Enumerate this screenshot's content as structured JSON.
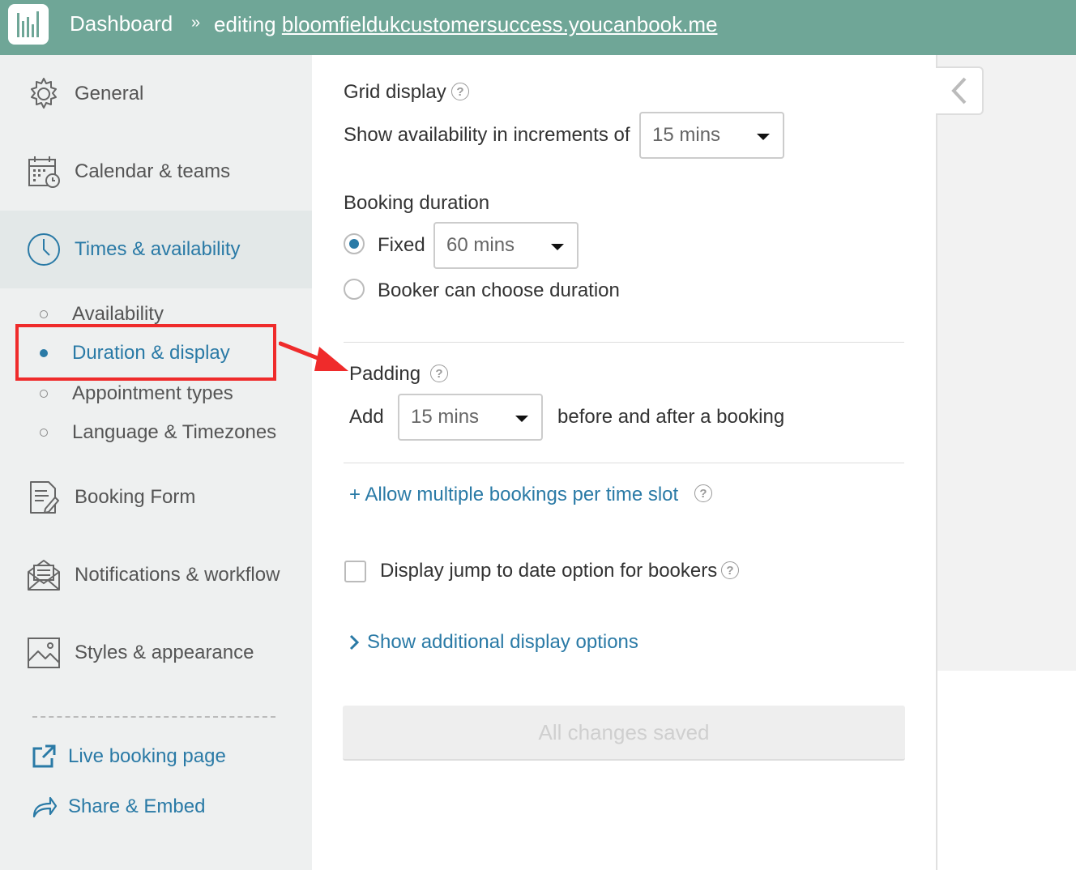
{
  "header": {
    "dashboard_label": "Dashboard",
    "separator": "»",
    "editing_prefix": "editing",
    "editing_site": "bloomfieldukcustomersuccess.youcanbook.me"
  },
  "sidebar": {
    "items": [
      {
        "label": "General",
        "icon": "gear-icon"
      },
      {
        "label": "Calendar & teams",
        "icon": "calendar-icon"
      },
      {
        "label": "Times & availability",
        "icon": "clock-icon"
      },
      {
        "label": "Booking Form",
        "icon": "form-icon"
      },
      {
        "label": "Notifications & workflow",
        "icon": "envelope-icon"
      },
      {
        "label": "Styles & appearance",
        "icon": "image-icon"
      }
    ],
    "sub_items": [
      {
        "label": "Availability"
      },
      {
        "label": "Duration & display"
      },
      {
        "label": "Appointment types"
      },
      {
        "label": "Language & Timezones"
      }
    ],
    "links": [
      {
        "label": "Live booking page",
        "icon": "external-link-icon"
      },
      {
        "label": "Share & Embed",
        "icon": "share-icon"
      }
    ]
  },
  "grid_display": {
    "title": "Grid display",
    "increments_label": "Show availability in increments of",
    "increments_value": "15 mins"
  },
  "booking_duration": {
    "title": "Booking duration",
    "fixed_label": "Fixed",
    "fixed_value": "60 mins",
    "choose_label": "Booker can choose duration"
  },
  "padding": {
    "title": "Padding",
    "add_label": "Add",
    "value": "15 mins",
    "suffix": "before and after a booking"
  },
  "multiple_bookings_link": "+ Allow multiple bookings per time slot",
  "jump_to_date_label": "Display jump to date option for bookers",
  "additional_options_link": "Show additional display options",
  "save_button": "All changes saved",
  "colors": {
    "header": "#6fa697",
    "accent": "#2a7aa6",
    "highlight": "#ef2b2b"
  }
}
